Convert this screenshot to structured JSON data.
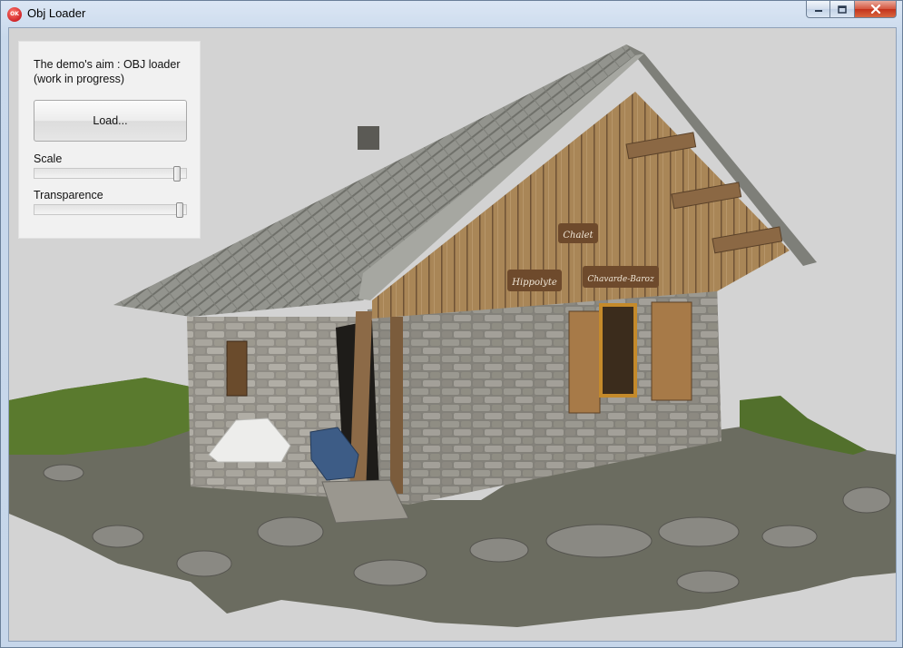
{
  "window": {
    "title": "Obj Loader",
    "app_icon_text": "OK",
    "minimize_icon": "minimize-icon",
    "maximize_icon": "maximize-icon",
    "close_icon": "close-icon",
    "accent_color": "#c3321c"
  },
  "panel": {
    "aim_text": "The demo's aim : OBJ loader (work in progress)",
    "load_label": "Load...",
    "scale_label": "Scale",
    "scale_value": 0.96,
    "transparence_label": "Transparence",
    "transparence_value": 0.98
  },
  "scene": {
    "sign_top": "Chalet",
    "sign_left": "Hippolyte",
    "sign_right": "Chavarde-Baroz",
    "background_color": "#d3d3d3"
  }
}
